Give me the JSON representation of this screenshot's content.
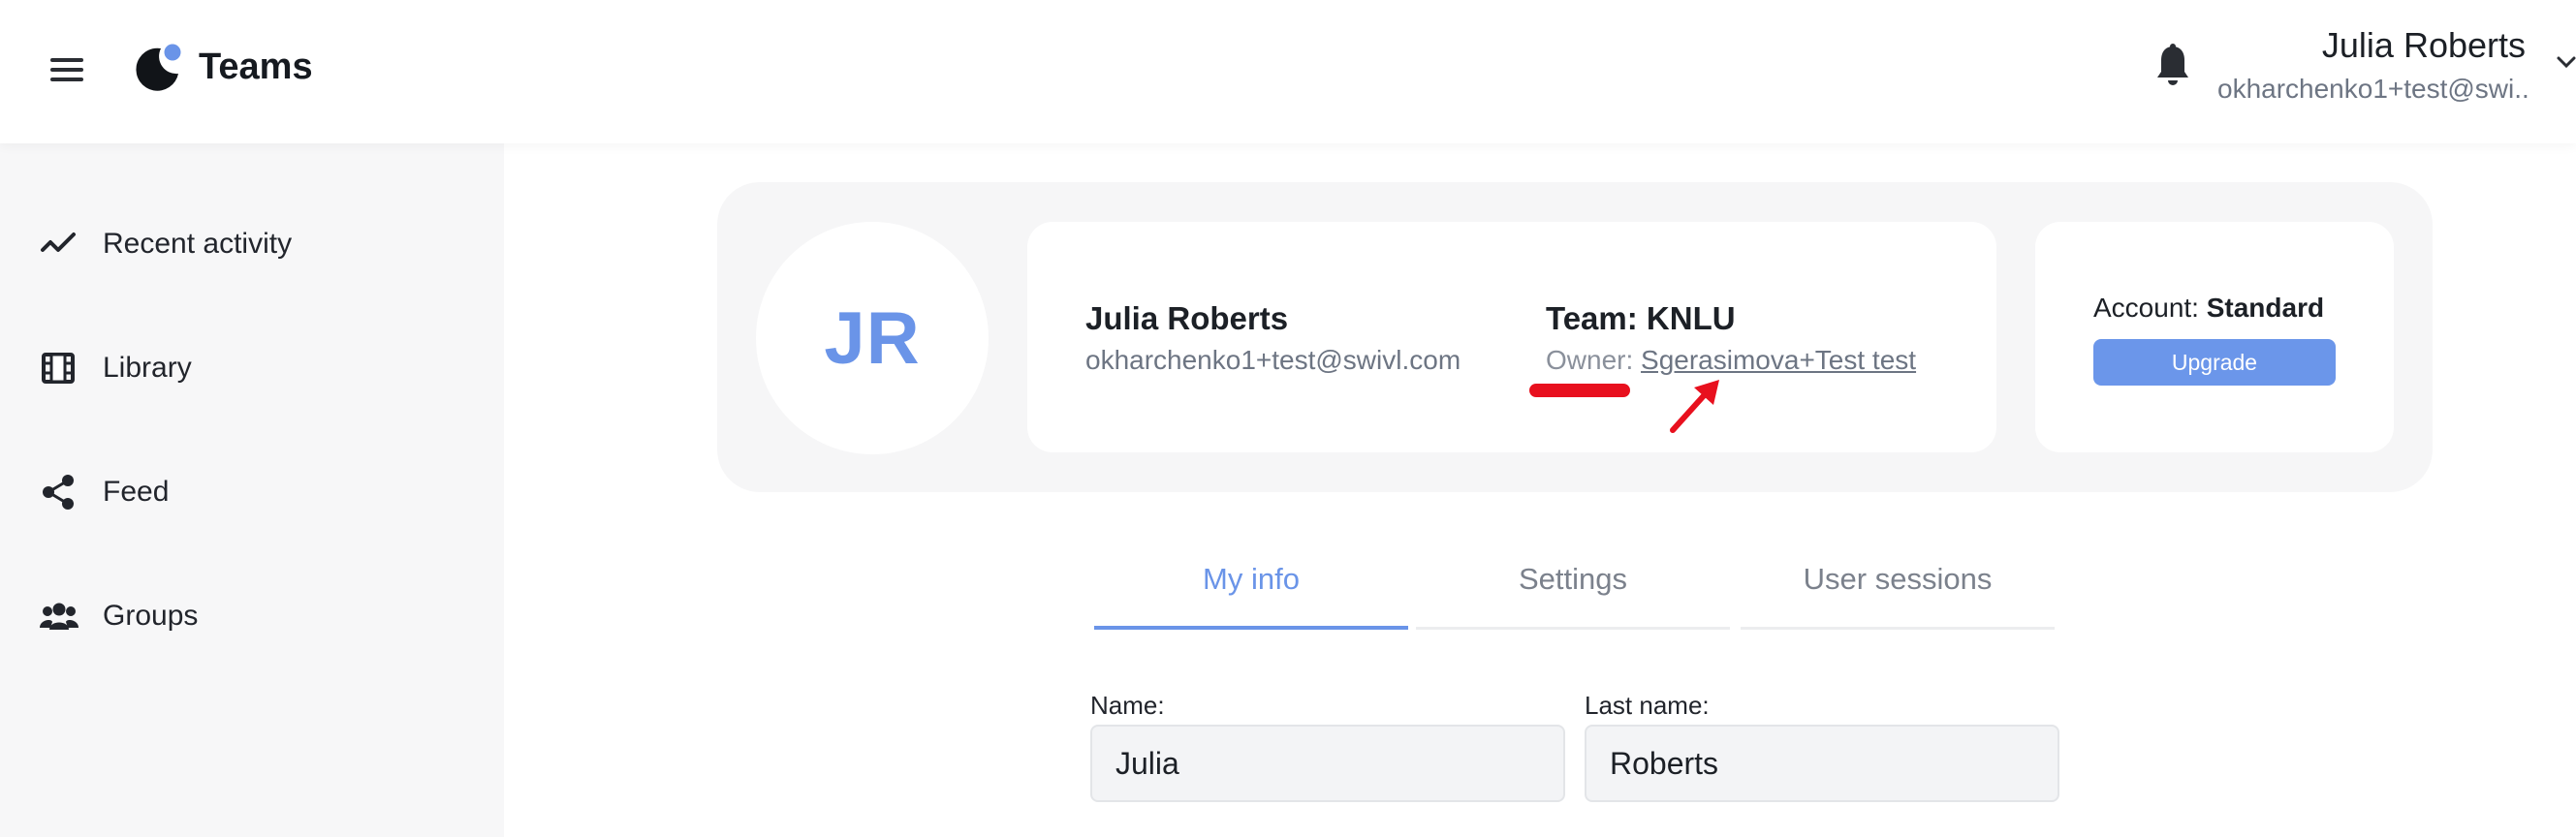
{
  "header": {
    "app_title": "Teams",
    "user_name": "Julia Roberts",
    "user_email": "okharchenko1+test@swi..."
  },
  "sidebar": {
    "items": [
      {
        "label": "Recent activity",
        "icon": "activity-icon"
      },
      {
        "label": "Library",
        "icon": "film-icon"
      },
      {
        "label": "Feed",
        "icon": "share-icon"
      },
      {
        "label": "Groups",
        "icon": "users-icon"
      }
    ]
  },
  "profile": {
    "initials": "JR",
    "name": "Julia Roberts",
    "email": "okharchenko1+test@swivl.com",
    "team_label": "Team: KNLU",
    "owner_prefix": "Owner:",
    "owner_name": "Sgerasimova+Test test",
    "account_prefix": "Account:",
    "account_type": "Standard",
    "upgrade_label": "Upgrade"
  },
  "tabs": [
    {
      "label": "My info",
      "active": true
    },
    {
      "label": "Settings",
      "active": false
    },
    {
      "label": "User sessions",
      "active": false
    }
  ],
  "form": {
    "first_name_label": "Name:",
    "first_name_value": "Julia",
    "last_name_label": "Last name:",
    "last_name_value": "Roberts"
  },
  "colors": {
    "accent": "#6a94e8",
    "annotation": "#e8101e",
    "sidebar_bg": "#f7f7f8"
  }
}
